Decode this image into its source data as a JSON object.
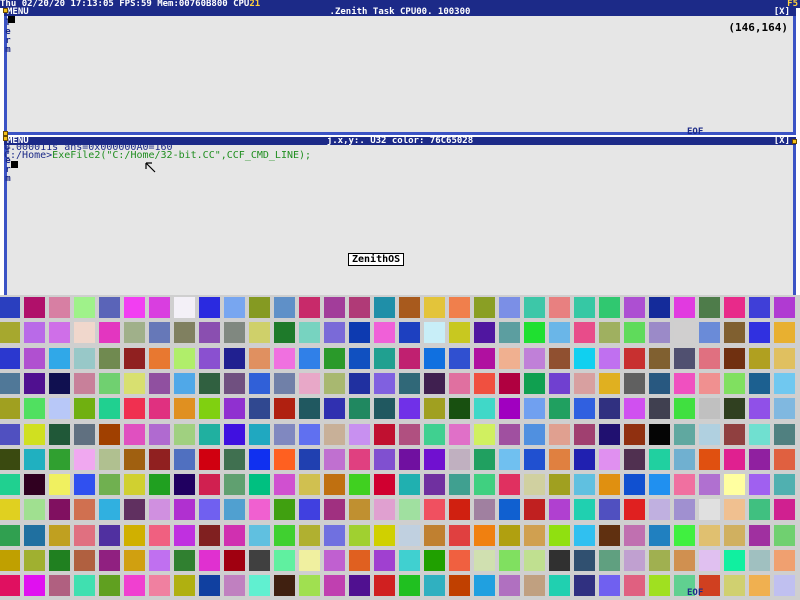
{
  "status_bar": {
    "day": "Thu",
    "date": "02/20/20",
    "time": "17:13:05",
    "fps_label": "FPS:",
    "fps": "59",
    "mem_label": "Mem:",
    "mem": "00760B800",
    "cpu_label": "CPU",
    "cpu_value": "21",
    "function_key": "F5"
  },
  "top_window": {
    "menu_label": "MENU",
    "title": ".Zenith Task CPU00. 100300",
    "close_label": "[X]",
    "side_letters": [
      "T",
      "e",
      "r",
      "m"
    ],
    "coords": "(146,164)",
    "eof_label": "EOF"
  },
  "bottom_window": {
    "menu_label": "MENU",
    "title": "j.x,y:. U32 color: 76C65028",
    "close_label": "[X]",
    "side_letters": [
      "T",
      "e",
      "r",
      "m"
    ],
    "line1": "0.000011s ans=0x000000A0=160",
    "prompt": "C:/Home>",
    "command": "ExeFile2(\"C:/Home/32-bit.CC\",CCF_CMD_LINE);",
    "os_label": "ZenithOS",
    "eof_label": "EOF"
  },
  "colors": {
    "bar": "#1c2a88",
    "border": "#3b53c5",
    "window_bg": "#e6e6e6",
    "command_text": "#1f8e1f",
    "accent": "#ffd23c",
    "corner": "#f6c21a"
  },
  "color_grid": {
    "cols": 32,
    "rows": 12,
    "palette": [
      "#2a3fbf",
      "#b0106a",
      "#d77fa3",
      "#9ff28a",
      "#5a64b8",
      "#f23ef2",
      "#d93ee0",
      "#f3f0f7",
      "#2a2ae0",
      "#78a6f0",
      "#859a22",
      "#5f90c8",
      "#c82a6a",
      "#a23d9a",
      "#b03a77",
      "#1f8fa8",
      "#a85a1d",
      "#e3c43a",
      "#f07f4c",
      "#8a9f24",
      "#7b8fe6",
      "#3dc7a8",
      "#e88080",
      "#36c8a4",
      "#30c870",
      "#ad4fd2",
      "#142b9a",
      "#e13ae0",
      "#4e7c4a",
      "#e82a8a",
      "#3f3fd8",
      "#b03ad2",
      "#a6a82e",
      "#b96ae8",
      "#cf6fe8",
      "#f0d7cc",
      "#e336c0",
      "#a0b08a",
      "#6678b8",
      "#808060",
      "#8a4fb0",
      "#808880",
      "#cfd06a",
      "#1e7a2a",
      "#77d3c0",
      "#7a6ad8",
      "#0d3ab0",
      "#f060d8",
      "#1d40c0",
      "#c8eef8",
      "#c8c820",
      "#5016a0",
      "#5c9ea0",
      "#1fe030",
      "#6ab6e8",
      "#e84c8a",
      "#9fb060",
      "#5fdb5b",
      "#9b8ac8",
      "#d0cfcf",
      "#6a8bd8",
      "#806030",
      "#3030e0",
      "#e8b030",
      "#2b38cf",
      "#b050d0",
      "#30a8e8",
      "#98c8c8",
      "#708a50",
      "#902020",
      "#e87830",
      "#b0ee6a",
      "#8a50d0",
      "#202090",
      "#e09060",
      "#f070e0",
      "#3080e8",
      "#2a9a2a",
      "#1050c0",
      "#20a090",
      "#c02070",
      "#1070e0",
      "#3050d0",
      "#b010a0",
      "#f0b090",
      "#c080d8",
      "#905030",
      "#10d0f0",
      "#c070f0",
      "#c83030",
      "#806030",
      "#505070",
      "#e07080",
      "#703010",
      "#b0a020",
      "#e0c060",
      "#507898",
      "#501090",
      "#101050",
      "#c8809a",
      "#70d070",
      "#d8e070",
      "#9050a0",
      "#50a8e8",
      "#306040",
      "#705080",
      "#3060d8",
      "#7080a8",
      "#e8a8c8",
      "#a8b870",
      "#2030a0",
      "#8060e0",
      "#306878",
      "#402050",
      "#e070a0",
      "#f05040",
      "#b00040",
      "#10a050",
      "#7040d0",
      "#d8a0a0",
      "#e0b020",
      "#606060",
      "#285880",
      "#f050c0",
      "#f09090",
      "#80e060",
      "#1c6090",
      "#70c8f0",
      "#a0a020",
      "#50e060",
      "#b8c8f8",
      "#70b010",
      "#20d090",
      "#f03050",
      "#e03080",
      "#e09020",
      "#80d010",
      "#9030d0",
      "#304890",
      "#b02010",
      "#205860",
      "#3030b0",
      "#208860",
      "#205860",
      "#7030e8",
      "#a0a020",
      "#185010",
      "#40d8c8",
      "#a000c0",
      "#70a0f0",
      "#20a060",
      "#3060e0",
      "#303080",
      "#d050f0",
      "#404050",
      "#40e040",
      "#c0c0c0",
      "#304020",
      "#9050e8",
      "#80b8e0",
      "#5050c0",
      "#d0e020",
      "#205838",
      "#607080",
      "#a04000",
      "#e050c0",
      "#b06ad0",
      "#a0d080",
      "#20b0a0",
      "#4010e0",
      "#20a8c0",
      "#8088c0",
      "#6070f0",
      "#c8b098",
      "#c890f0",
      "#c01030",
      "#b05080",
      "#40d090",
      "#e070c8",
      "#d0f060",
      "#a050a0",
      "#5090e0",
      "#e0a090",
      "#a04070",
      "#201070",
      "#903010",
      "#050505",
      "#60a8a0",
      "#b0d0e0",
      "#904040",
      "#70e0d0",
      "#508080",
      "#3a4a10",
      "#20b0c0",
      "#30a030",
      "#f0a8f0",
      "#b0c090",
      "#a06010",
      "#902020",
      "#5070c0",
      "#d00010",
      "#407050",
      "#1030f0",
      "#ff6020",
      "#2040b0",
      "#c070d0",
      "#e04080",
      "#8050d0",
      "#7010a0",
      "#7010d0",
      "#c0b0c0",
      "#20a060",
      "#70c0f0",
      "#2050d0",
      "#e08040",
      "#2020b0",
      "#e090f0",
      "#503050",
      "#20d0a0",
      "#70b0d0",
      "#e05010",
      "#e02090",
      "#9020a0",
      "#e06040",
      "#20d090",
      "#300020",
      "#f0f060",
      "#3050f0",
      "#70b050",
      "#d0d030",
      "#20a020",
      "#200060",
      "#d02050",
      "#60a070",
      "#00c080",
      "#d050d0",
      "#d0c050",
      "#c07010",
      "#40d020",
      "#d00030",
      "#20b0b0",
      "#7030a0",
      "#40a090",
      "#40d080",
      "#e03060",
      "#d0d0a0",
      "#a0a020",
      "#60c0e0",
      "#e09010",
      "#1050d0",
      "#2090f0",
      "#f070a0",
      "#b070d0",
      "#ffffa0",
      "#a060f0",
      "#50b0b0",
      "#e0d020",
      "#a0e090",
      "#801060",
      "#d07050",
      "#30b0e0",
      "#603060",
      "#d090e0",
      "#b030d0",
      "#7060f0",
      "#50a0d0",
      "#f060d0",
      "#40a010",
      "#4040e0",
      "#a03080",
      "#c09030",
      "#e0a0d0",
      "#a0e0a0",
      "#f05060",
      "#d02010",
      "#a080a0",
      "#1060d0",
      "#c02020",
      "#b040d0",
      "#20d0b0",
      "#5050c0",
      "#e02020",
      "#c0b0e0",
      "#a090d0",
      "#e0e0e0",
      "#f0c090",
      "#40c080",
      "#d02090",
      "#30a050",
      "#2070a0",
      "#c0a020",
      "#e07080",
      "#5030a0",
      "#d0b000",
      "#f06080",
      "#c030e0",
      "#802020",
      "#d030b0",
      "#60c0e0",
      "#40d030",
      "#b0b030",
      "#7070e0",
      "#a0d030",
      "#d0d000",
      "#c0d0e0",
      "#c08030",
      "#e04040",
      "#f08010",
      "#b0a010",
      "#d0a050",
      "#90e010",
      "#30c0f0",
      "#603010",
      "#c070b0",
      "#2080c0",
      "#40f040",
      "#e0c070",
      "#d0b060",
      "#a030a0",
      "#70d070",
      "#c0a000",
      "#a0b030",
      "#208020",
      "#b06040",
      "#902080",
      "#d0a010",
      "#c070f0",
      "#308030",
      "#e030d0",
      "#a00010",
      "#404040",
      "#60f0a0",
      "#f0f0a0",
      "#c060d0",
      "#e06020",
      "#a040d0",
      "#40d0d0",
      "#20a000",
      "#f06040",
      "#d0e0b0",
      "#80e060",
      "#c0e090",
      "#303030",
      "#305070",
      "#60a080",
      "#c0a0d0",
      "#a0b050",
      "#d09050",
      "#e0c0f0",
      "#10f0a0",
      "#a0c0c0",
      "#f0a070",
      "#e01060",
      "#e010f0",
      "#b06080",
      "#40e0b0",
      "#60a020",
      "#f040d0",
      "#f080a0",
      "#b0b010",
      "#1040a0",
      "#c080c0",
      "#60f0d0",
      "#402010",
      "#a0e050",
      "#c040b0",
      "#501090",
      "#d02020",
      "#20c020",
      "#30b0c0",
      "#c04000",
      "#20a0e0",
      "#b070c0",
      "#c0a080",
      "#20d0b0",
      "#303080",
      "#7060f0",
      "#e06080",
      "#a0e020",
      "#60d090",
      "#d04020",
      "#d0d070",
      "#f0b050",
      "#c0c0f0"
    ]
  }
}
